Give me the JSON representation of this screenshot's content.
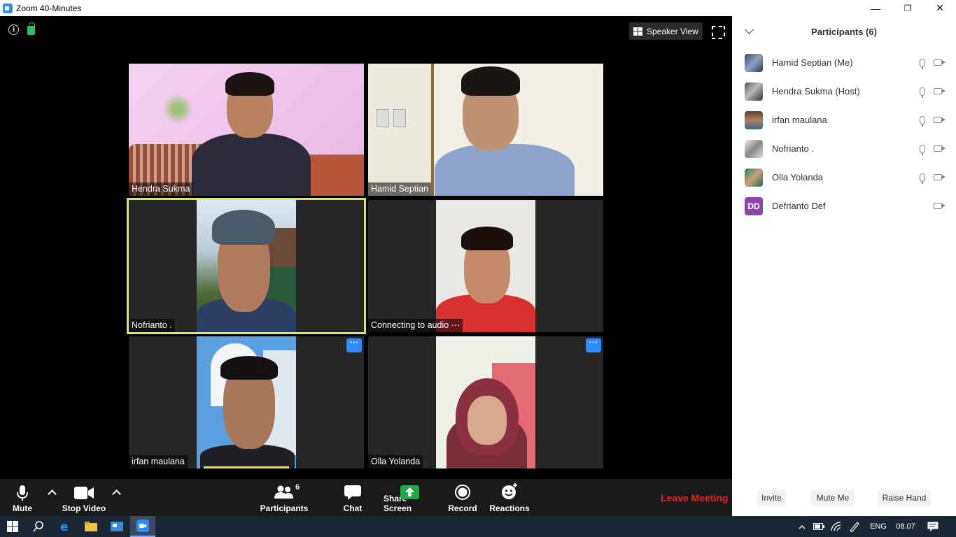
{
  "window": {
    "title": "Zoom 40-Minutes",
    "minimize": "—",
    "restore": "❐",
    "close": "✕"
  },
  "meeting": {
    "speaker_view_label": "Speaker View",
    "tiles": [
      {
        "name": "Hendra Sukma"
      },
      {
        "name": "Hamid Septian"
      },
      {
        "name": "Nofrianto ."
      },
      {
        "name": "Connecting to audio"
      },
      {
        "name": "irfan maulana"
      },
      {
        "name": "Olla Yolanda"
      }
    ],
    "more_label": "···",
    "connecting_dots": "···"
  },
  "toolbar": {
    "mute": "Mute",
    "stop_video": "Stop Video",
    "participants": "Participants",
    "participants_count": "6",
    "chat": "Chat",
    "share_screen": "Share Screen",
    "record": "Record",
    "reactions": "Reactions",
    "leave": "Leave Meeting"
  },
  "panel": {
    "title": "Participants (6)",
    "participants": [
      {
        "name": "Hamid Septian (Me)"
      },
      {
        "name": "Hendra Sukma (Host)"
      },
      {
        "name": "irfan maulana"
      },
      {
        "name": "Nofrianto ."
      },
      {
        "name": "Olla Yolanda"
      },
      {
        "name": "Defrianto Def",
        "initials": "DD"
      }
    ],
    "invite": "Invite",
    "mute_me": "Mute Me",
    "raise_hand": "Raise Hand"
  },
  "taskbar": {
    "language": "ENG",
    "time": "08.07"
  },
  "colors": {
    "accent": "#2d8cff",
    "leave": "#e02828",
    "active_speaker": "#d7e36f",
    "avatar_dd": "#8e44ad"
  }
}
